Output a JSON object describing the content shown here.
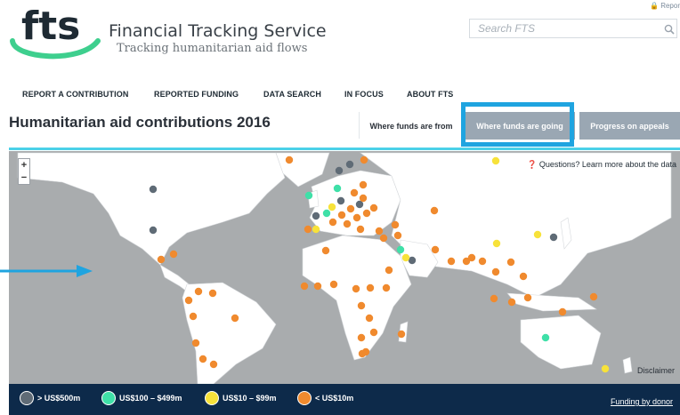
{
  "header": {
    "report_link": "Repor",
    "brand_logo": "fts",
    "brand_title": "Financial Tracking Service",
    "brand_subtitle": "Tracking humanitarian aid flows",
    "search_placeholder": "Search FTS",
    "search_icon": "search-icon"
  },
  "nav": {
    "items": [
      {
        "label": "REPORT A CONTRIBUTION"
      },
      {
        "label": "REPORTED FUNDING"
      },
      {
        "label": "DATA SEARCH"
      },
      {
        "label": "IN FOCUS"
      },
      {
        "label": "ABOUT FTS"
      }
    ]
  },
  "page": {
    "title": "Humanitarian aid contributions 2016",
    "tabs": [
      {
        "label": "Where funds are from",
        "active": false
      },
      {
        "label": "Where funds are going",
        "active": true
      },
      {
        "label": "Progress on appeals",
        "active": false
      }
    ]
  },
  "map": {
    "zoom_in": "+",
    "zoom_out": "−",
    "questions_text": "Questions? Learn more about the data",
    "disclaimer": "Disclaimer",
    "colors": {
      "water": "#a9acae",
      "land": "#ffffff",
      "gt500": "#5f6b76",
      "r100_499": "#3fe0a8",
      "r10_99": "#f7e23a",
      "lt10": "#f08a2e"
    }
  },
  "legend": {
    "items": [
      {
        "label": "> US$500m",
        "color": "#5f6b76"
      },
      {
        "label": "US$100 – $499m",
        "color": "#3fe0a8"
      },
      {
        "label": "US$10 – $99m",
        "color": "#f7e23a"
      },
      {
        "label": "< US$10m",
        "color": "#f08a2e"
      }
    ],
    "by_donor_link": "Funding by donor"
  },
  "annotations": {
    "accent": "#1fa4e0"
  }
}
